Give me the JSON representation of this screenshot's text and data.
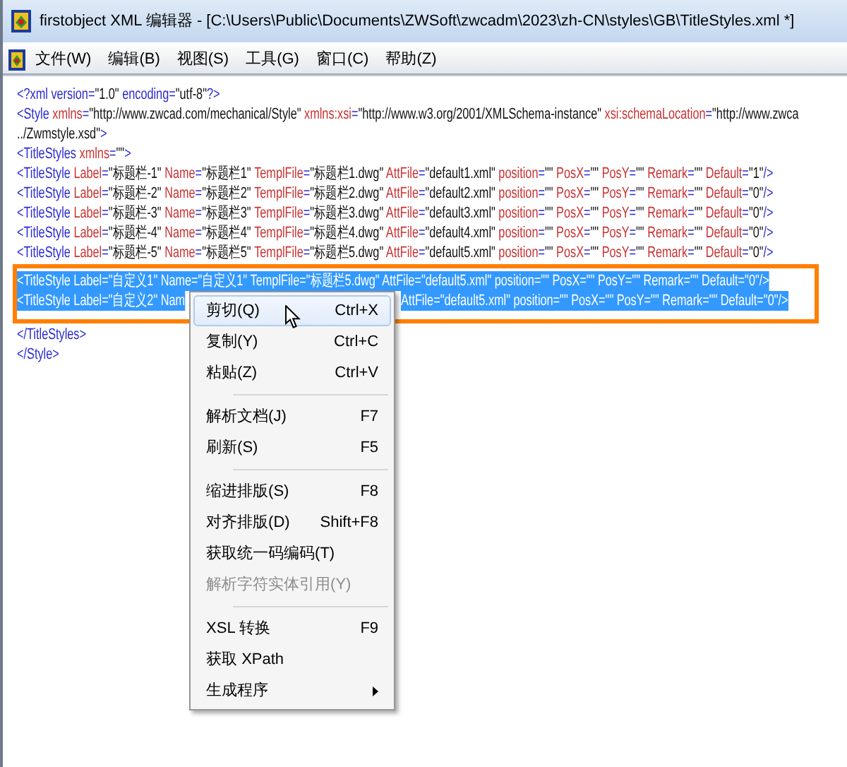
{
  "window": {
    "title": "firstobject XML 编辑器 - [C:\\Users\\Public\\Documents\\ZWSoft\\zwcadm\\2023\\zh-CN\\styles\\GB\\TitleStyles.xml *]"
  },
  "menu_bar": [
    "文件(W)",
    "编辑(B)",
    "视图(S)",
    "工具(G)",
    "窗口(C)",
    "帮助(Z)"
  ],
  "editor": {
    "lines": [
      {
        "selected": false,
        "tokens": [
          {
            "kind": "tag",
            "text": "<?xml version"
          },
          {
            "kind": "op",
            "text": "="
          },
          {
            "kind": "value",
            "text": "\"1.0\""
          },
          {
            "kind": "tag",
            "text": " encoding"
          },
          {
            "kind": "op",
            "text": "="
          },
          {
            "kind": "value",
            "text": "\"utf-8\""
          },
          {
            "kind": "tag",
            "text": "?>"
          }
        ]
      },
      {
        "selected": false,
        "tokens": [
          {
            "kind": "tag",
            "text": "<Style"
          },
          {
            "kind": "attr",
            "text": " xmlns"
          },
          {
            "kind": "op",
            "text": "="
          },
          {
            "kind": "value",
            "text": "\"http://www.zwcad.com/mechanical/Style\""
          },
          {
            "kind": "attr",
            "text": " xmlns:xsi"
          },
          {
            "kind": "op",
            "text": "="
          },
          {
            "kind": "value",
            "text": "\"http://www.w3.org/2001/XMLSchema-instance\""
          },
          {
            "kind": "attr",
            "text": " xsi:schemaLocation"
          },
          {
            "kind": "op",
            "text": "="
          },
          {
            "kind": "value",
            "text": "\"http://www.zwca"
          }
        ]
      },
      {
        "selected": false,
        "tokens": [
          {
            "kind": "value",
            "text": "../Zwmstyle.xsd\""
          },
          {
            "kind": "tag",
            "text": ">"
          }
        ]
      },
      {
        "selected": false,
        "tokens": [
          {
            "kind": "tag",
            "text": "<TitleStyles"
          },
          {
            "kind": "attr",
            "text": " xmlns"
          },
          {
            "kind": "op",
            "text": "="
          },
          {
            "kind": "value",
            "text": "\"\""
          },
          {
            "kind": "tag",
            "text": ">"
          }
        ]
      },
      {
        "selected": false,
        "tokens": [
          {
            "kind": "tag",
            "text": "<TitleStyle"
          },
          {
            "kind": "attr",
            "text": " Label"
          },
          {
            "kind": "op",
            "text": "="
          },
          {
            "kind": "value",
            "text": "\"标题栏-1\""
          },
          {
            "kind": "attr",
            "text": " Name"
          },
          {
            "kind": "op",
            "text": "="
          },
          {
            "kind": "value",
            "text": "\"标题栏1\""
          },
          {
            "kind": "attr",
            "text": " TemplFile"
          },
          {
            "kind": "op",
            "text": "="
          },
          {
            "kind": "value",
            "text": "\"标题栏1.dwg\""
          },
          {
            "kind": "attr",
            "text": " AttFile"
          },
          {
            "kind": "op",
            "text": "="
          },
          {
            "kind": "value",
            "text": "\"default1.xml\""
          },
          {
            "kind": "attr",
            "text": " position"
          },
          {
            "kind": "op",
            "text": "="
          },
          {
            "kind": "value",
            "text": "\"\""
          },
          {
            "kind": "attr",
            "text": " PosX"
          },
          {
            "kind": "op",
            "text": "="
          },
          {
            "kind": "value",
            "text": "\"\""
          },
          {
            "kind": "attr",
            "text": " PosY"
          },
          {
            "kind": "op",
            "text": "="
          },
          {
            "kind": "value",
            "text": "\"\""
          },
          {
            "kind": "attr",
            "text": " Remark"
          },
          {
            "kind": "op",
            "text": "="
          },
          {
            "kind": "value",
            "text": "\"\""
          },
          {
            "kind": "attr",
            "text": " Default"
          },
          {
            "kind": "op",
            "text": "="
          },
          {
            "kind": "value",
            "text": "\"1\""
          },
          {
            "kind": "tag",
            "text": "/>"
          }
        ]
      },
      {
        "selected": false,
        "tokens": [
          {
            "kind": "tag",
            "text": "<TitleStyle"
          },
          {
            "kind": "attr",
            "text": " Label"
          },
          {
            "kind": "op",
            "text": "="
          },
          {
            "kind": "value",
            "text": "\"标题栏-2\""
          },
          {
            "kind": "attr",
            "text": " Name"
          },
          {
            "kind": "op",
            "text": "="
          },
          {
            "kind": "value",
            "text": "\"标题栏2\""
          },
          {
            "kind": "attr",
            "text": " TemplFile"
          },
          {
            "kind": "op",
            "text": "="
          },
          {
            "kind": "value",
            "text": "\"标题栏2.dwg\""
          },
          {
            "kind": "attr",
            "text": " AttFile"
          },
          {
            "kind": "op",
            "text": "="
          },
          {
            "kind": "value",
            "text": "\"default2.xml\""
          },
          {
            "kind": "attr",
            "text": " position"
          },
          {
            "kind": "op",
            "text": "="
          },
          {
            "kind": "value",
            "text": "\"\""
          },
          {
            "kind": "attr",
            "text": " PosX"
          },
          {
            "kind": "op",
            "text": "="
          },
          {
            "kind": "value",
            "text": "\"\""
          },
          {
            "kind": "attr",
            "text": " PosY"
          },
          {
            "kind": "op",
            "text": "="
          },
          {
            "kind": "value",
            "text": "\"\""
          },
          {
            "kind": "attr",
            "text": " Remark"
          },
          {
            "kind": "op",
            "text": "="
          },
          {
            "kind": "value",
            "text": "\"\""
          },
          {
            "kind": "attr",
            "text": " Default"
          },
          {
            "kind": "op",
            "text": "="
          },
          {
            "kind": "value",
            "text": "\"0\""
          },
          {
            "kind": "tag",
            "text": "/>"
          }
        ]
      },
      {
        "selected": false,
        "tokens": [
          {
            "kind": "tag",
            "text": "<TitleStyle"
          },
          {
            "kind": "attr",
            "text": " Label"
          },
          {
            "kind": "op",
            "text": "="
          },
          {
            "kind": "value",
            "text": "\"标题栏-3\""
          },
          {
            "kind": "attr",
            "text": " Name"
          },
          {
            "kind": "op",
            "text": "="
          },
          {
            "kind": "value",
            "text": "\"标题栏3\""
          },
          {
            "kind": "attr",
            "text": " TemplFile"
          },
          {
            "kind": "op",
            "text": "="
          },
          {
            "kind": "value",
            "text": "\"标题栏3.dwg\""
          },
          {
            "kind": "attr",
            "text": " AttFile"
          },
          {
            "kind": "op",
            "text": "="
          },
          {
            "kind": "value",
            "text": "\"default3.xml\""
          },
          {
            "kind": "attr",
            "text": " position"
          },
          {
            "kind": "op",
            "text": "="
          },
          {
            "kind": "value",
            "text": "\"\""
          },
          {
            "kind": "attr",
            "text": " PosX"
          },
          {
            "kind": "op",
            "text": "="
          },
          {
            "kind": "value",
            "text": "\"\""
          },
          {
            "kind": "attr",
            "text": " PosY"
          },
          {
            "kind": "op",
            "text": "="
          },
          {
            "kind": "value",
            "text": "\"\""
          },
          {
            "kind": "attr",
            "text": " Remark"
          },
          {
            "kind": "op",
            "text": "="
          },
          {
            "kind": "value",
            "text": "\"\""
          },
          {
            "kind": "attr",
            "text": " Default"
          },
          {
            "kind": "op",
            "text": "="
          },
          {
            "kind": "value",
            "text": "\"0\""
          },
          {
            "kind": "tag",
            "text": "/>"
          }
        ]
      },
      {
        "selected": false,
        "tokens": [
          {
            "kind": "tag",
            "text": "<TitleStyle"
          },
          {
            "kind": "attr",
            "text": " Label"
          },
          {
            "kind": "op",
            "text": "="
          },
          {
            "kind": "value",
            "text": "\"标题栏-4\""
          },
          {
            "kind": "attr",
            "text": " Name"
          },
          {
            "kind": "op",
            "text": "="
          },
          {
            "kind": "value",
            "text": "\"标题栏4\""
          },
          {
            "kind": "attr",
            "text": " TemplFile"
          },
          {
            "kind": "op",
            "text": "="
          },
          {
            "kind": "value",
            "text": "\"标题栏4.dwg\""
          },
          {
            "kind": "attr",
            "text": " AttFile"
          },
          {
            "kind": "op",
            "text": "="
          },
          {
            "kind": "value",
            "text": "\"default4.xml\""
          },
          {
            "kind": "attr",
            "text": " position"
          },
          {
            "kind": "op",
            "text": "="
          },
          {
            "kind": "value",
            "text": "\"\""
          },
          {
            "kind": "attr",
            "text": " PosX"
          },
          {
            "kind": "op",
            "text": "="
          },
          {
            "kind": "value",
            "text": "\"\""
          },
          {
            "kind": "attr",
            "text": " PosY"
          },
          {
            "kind": "op",
            "text": "="
          },
          {
            "kind": "value",
            "text": "\"\""
          },
          {
            "kind": "attr",
            "text": " Remark"
          },
          {
            "kind": "op",
            "text": "="
          },
          {
            "kind": "value",
            "text": "\"\""
          },
          {
            "kind": "attr",
            "text": " Default"
          },
          {
            "kind": "op",
            "text": "="
          },
          {
            "kind": "value",
            "text": "\"0\""
          },
          {
            "kind": "tag",
            "text": "/>"
          }
        ]
      },
      {
        "selected": false,
        "tokens": [
          {
            "kind": "tag",
            "text": "<TitleStyle"
          },
          {
            "kind": "attr",
            "text": " Label"
          },
          {
            "kind": "op",
            "text": "="
          },
          {
            "kind": "value",
            "text": "\"标题栏-5\""
          },
          {
            "kind": "attr",
            "text": " Name"
          },
          {
            "kind": "op",
            "text": "="
          },
          {
            "kind": "value",
            "text": "\"标题栏5\""
          },
          {
            "kind": "attr",
            "text": " TemplFile"
          },
          {
            "kind": "op",
            "text": "="
          },
          {
            "kind": "value",
            "text": "\"标题栏5.dwg\""
          },
          {
            "kind": "attr",
            "text": " AttFile"
          },
          {
            "kind": "op",
            "text": "="
          },
          {
            "kind": "value",
            "text": "\"default5.xml\""
          },
          {
            "kind": "attr",
            "text": " position"
          },
          {
            "kind": "op",
            "text": "="
          },
          {
            "kind": "value",
            "text": "\"\""
          },
          {
            "kind": "attr",
            "text": " PosX"
          },
          {
            "kind": "op",
            "text": "="
          },
          {
            "kind": "value",
            "text": "\"\""
          },
          {
            "kind": "attr",
            "text": " PosY"
          },
          {
            "kind": "op",
            "text": "="
          },
          {
            "kind": "value",
            "text": "\"\""
          },
          {
            "kind": "attr",
            "text": " Remark"
          },
          {
            "kind": "op",
            "text": "="
          },
          {
            "kind": "value",
            "text": "\"\""
          },
          {
            "kind": "attr",
            "text": " Default"
          },
          {
            "kind": "op",
            "text": "="
          },
          {
            "kind": "value",
            "text": "\"0\""
          },
          {
            "kind": "tag",
            "text": "/>"
          }
        ]
      },
      {
        "selected": true,
        "text": "<TitleStyle Label=\"自定义1\" Name=\"自定义1\" TemplFile=\"标题栏5.dwg\" AttFile=\"default5.xml\" position=\"\" PosX=\"\" PosY=\"\" Remark=\"\" Default=\"0\"/>"
      },
      {
        "selected": true,
        "text": "<TitleStyle Label=\"自定义2\" Nam",
        "after_menu": "AttFile=\"default5.xml\" position=\"\" PosX=\"\" PosY=\"\" Remark=\"\" Default=\"0\"/>"
      },
      {
        "selected": false,
        "tokens": [
          {
            "kind": "tag",
            "text": "</TitleStyles>"
          }
        ]
      },
      {
        "selected": false,
        "tokens": [
          {
            "kind": "tag",
            "text": "</Style>"
          }
        ]
      }
    ]
  },
  "context_menu": [
    {
      "kind": "item",
      "label": "剪切(Q)",
      "shortcut": "Ctrl+X",
      "selected": true,
      "disabled": false
    },
    {
      "kind": "item",
      "label": "复制(Y)",
      "shortcut": "Ctrl+C",
      "selected": false,
      "disabled": false
    },
    {
      "kind": "item",
      "label": "粘贴(Z)",
      "shortcut": "Ctrl+V",
      "selected": false,
      "disabled": false
    },
    {
      "kind": "separator"
    },
    {
      "kind": "item",
      "label": "解析文档(J)",
      "shortcut": "F7",
      "selected": false,
      "disabled": false
    },
    {
      "kind": "item",
      "label": "刷新(S)",
      "shortcut": "F5",
      "selected": false,
      "disabled": false
    },
    {
      "kind": "separator"
    },
    {
      "kind": "item",
      "label": "缩进排版(S)",
      "shortcut": "F8",
      "selected": false,
      "disabled": false
    },
    {
      "kind": "item",
      "label": "对齐排版(D)",
      "shortcut": "Shift+F8",
      "selected": false,
      "disabled": false
    },
    {
      "kind": "item",
      "label": "获取统一码编码(T)",
      "selected": false,
      "disabled": false
    },
    {
      "kind": "item",
      "label": "解析字符实体引用(Y)",
      "selected": false,
      "disabled": true
    },
    {
      "kind": "separator"
    },
    {
      "kind": "item",
      "label": "XSL 转换",
      "shortcut": "F9",
      "selected": false,
      "disabled": false
    },
    {
      "kind": "item",
      "label": "获取 XPath",
      "selected": false,
      "disabled": false
    },
    {
      "kind": "submenu",
      "label": "生成程序",
      "selected": false,
      "disabled": false
    }
  ]
}
